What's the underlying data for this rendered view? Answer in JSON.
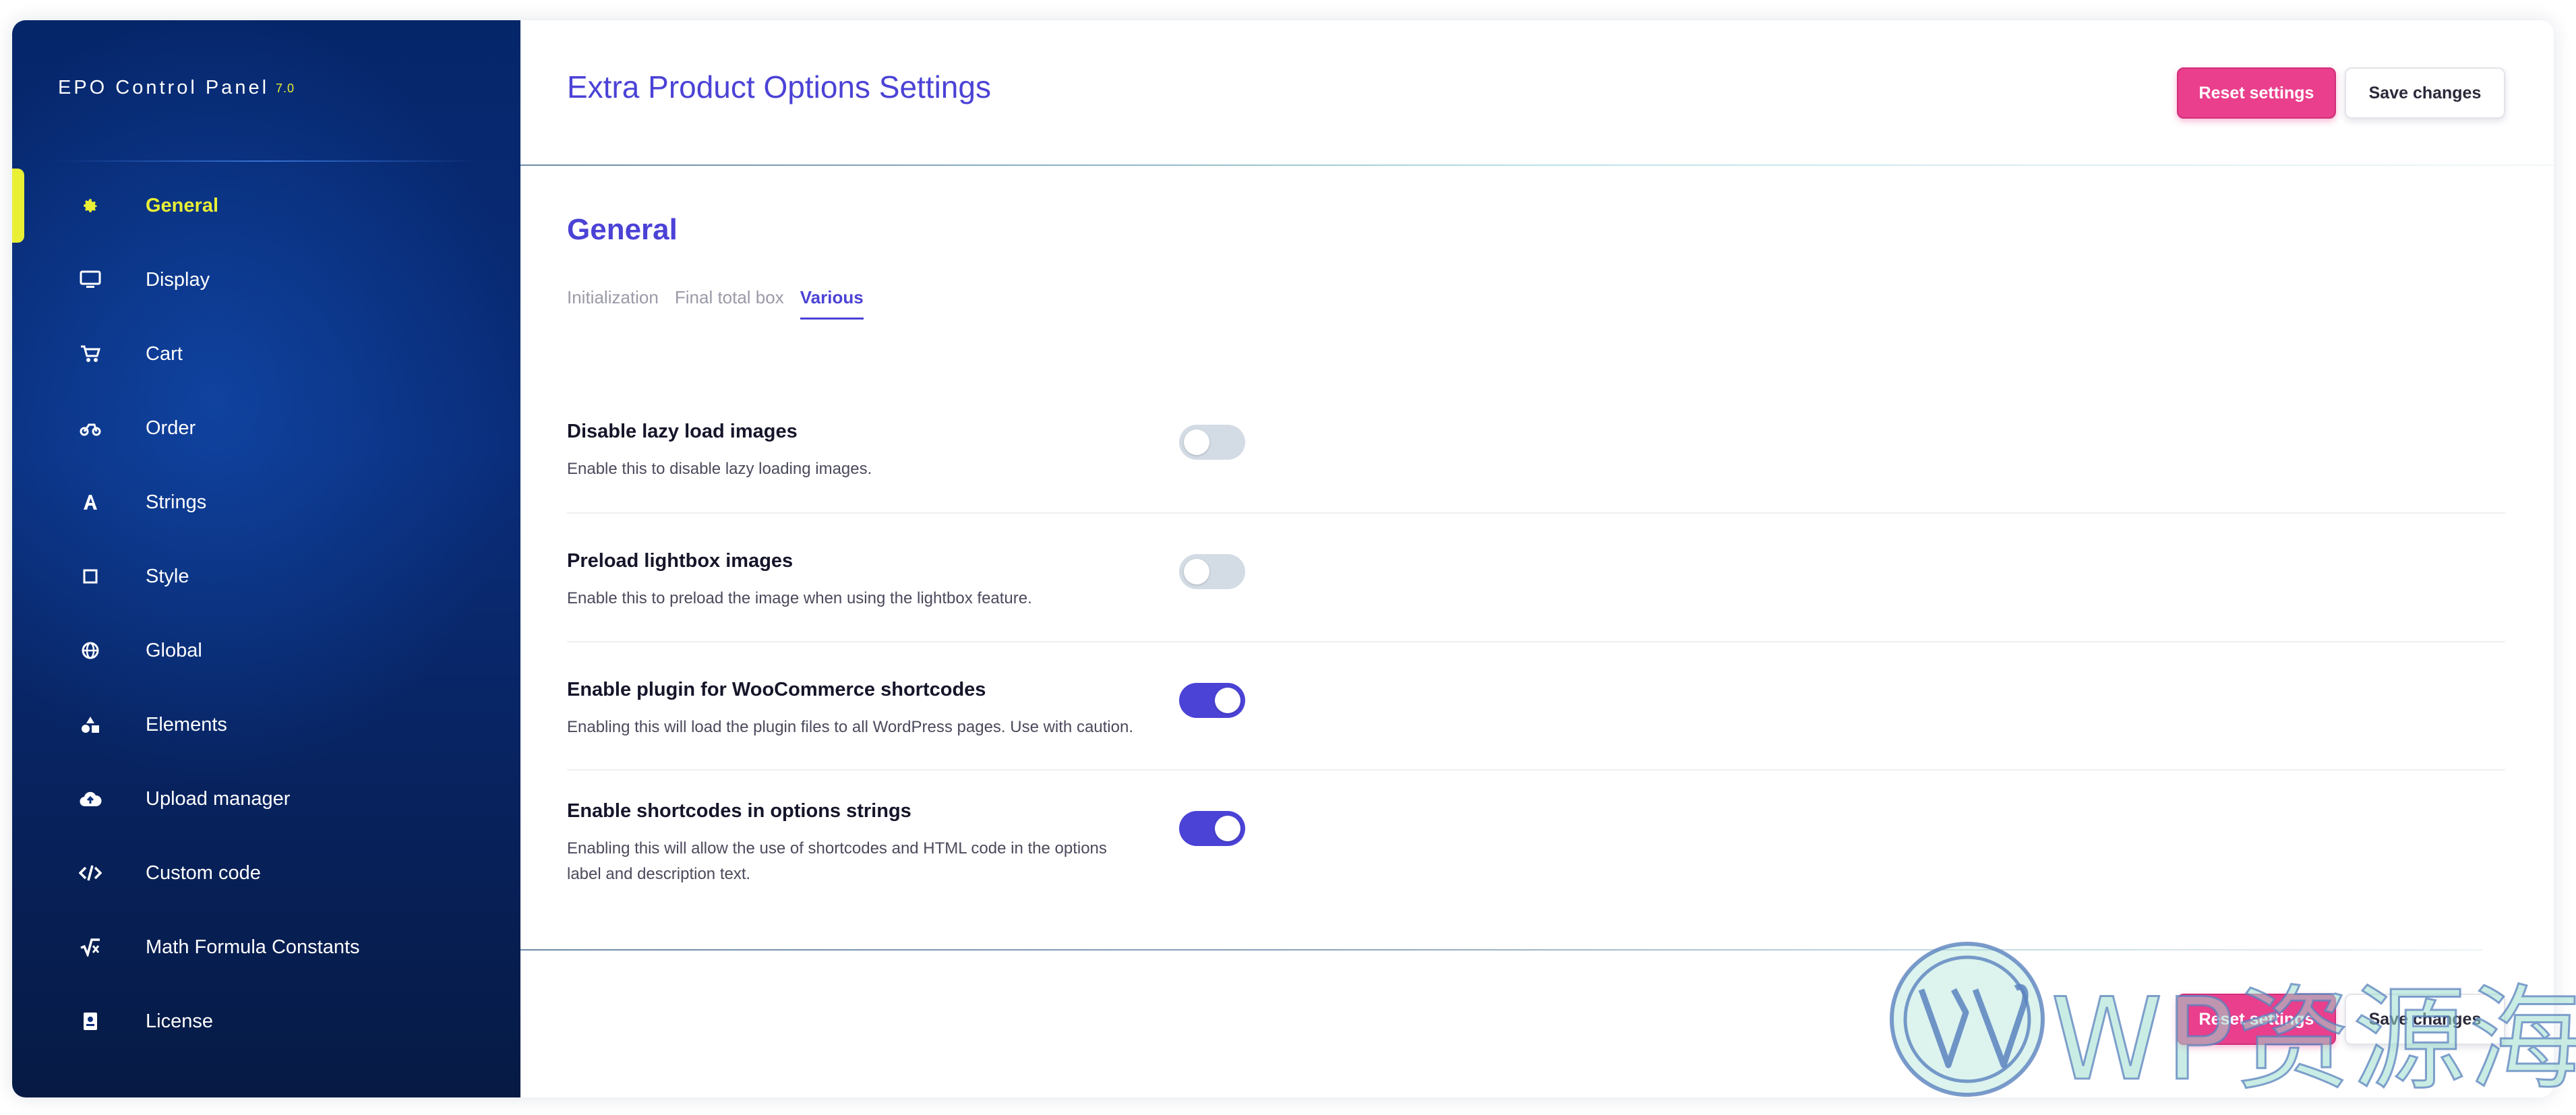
{
  "colors": {
    "accent": "#4b42d6",
    "sidebar_active": "#e9ef35",
    "reset_button": "#ea3f8c",
    "toggle_off": "#d3dbe4",
    "sidebar_bg": "#0a2d7a"
  },
  "sidebar": {
    "brand": "EPO Control Panel",
    "version": "7.0",
    "items": [
      {
        "label": "General",
        "icon": "gear-icon",
        "active": true
      },
      {
        "label": "Display",
        "icon": "monitor-icon",
        "active": false
      },
      {
        "label": "Cart",
        "icon": "cart-icon",
        "active": false
      },
      {
        "label": "Order",
        "icon": "order-icon",
        "active": false
      },
      {
        "label": "Strings",
        "icon": "font-icon",
        "active": false
      },
      {
        "label": "Style",
        "icon": "square-icon",
        "active": false
      },
      {
        "label": "Global",
        "icon": "globe-icon",
        "active": false
      },
      {
        "label": "Elements",
        "icon": "shapes-icon",
        "active": false
      },
      {
        "label": "Upload manager",
        "icon": "cloud-upload-icon",
        "active": false
      },
      {
        "label": "Custom code",
        "icon": "code-icon",
        "active": false
      },
      {
        "label": "Math Formula Constants",
        "icon": "square-root-icon",
        "active": false
      },
      {
        "label": "License",
        "icon": "id-card-icon",
        "active": false
      }
    ]
  },
  "header": {
    "title": "Extra Product Options Settings",
    "reset_label": "Reset settings",
    "save_label": "Save changes"
  },
  "section": {
    "title": "General",
    "tabs": [
      {
        "label": "Initialization",
        "active": false
      },
      {
        "label": "Final total box",
        "active": false
      },
      {
        "label": "Various",
        "active": true
      }
    ]
  },
  "settings": [
    {
      "title": "Disable lazy load images",
      "description": [
        "Enable this to disable lazy loading images."
      ],
      "enabled": false
    },
    {
      "title": "Preload lightbox images",
      "description": [
        "Enable this to preload the image when using the lightbox feature."
      ],
      "enabled": false
    },
    {
      "title": "Enable plugin for WooCommerce shortcodes",
      "description": [
        "Enabling this will load the plugin files to all WordPress pages. Use with caution."
      ],
      "enabled": true
    },
    {
      "title": "Enable shortcodes in options strings",
      "description": [
        "Enabling this will allow the use of shortcodes and HTML code in the options",
        "label and description text."
      ],
      "enabled": true
    }
  ],
  "footer": {
    "reset_label": "Reset settings",
    "save_label": "Save changes"
  },
  "watermark": {
    "text": "WP资源海",
    "logo_icon": "wordpress-logo-icon"
  }
}
